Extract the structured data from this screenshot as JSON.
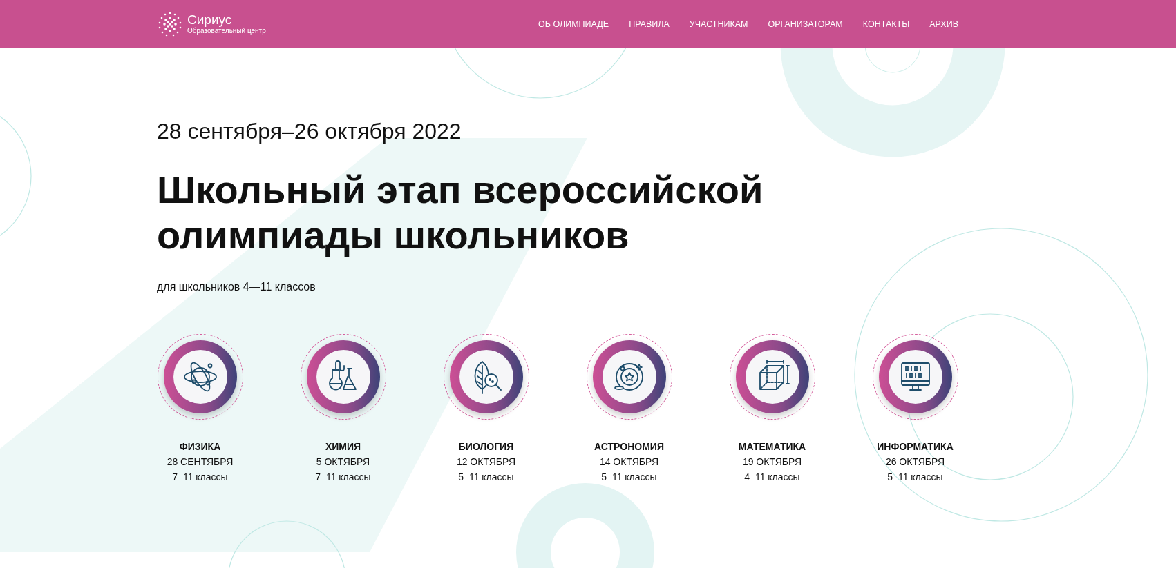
{
  "header": {
    "logo": {
      "name": "Сириус",
      "tagline": "Образовательный центр"
    },
    "nav": [
      "ОБ ОЛИМПИАДЕ",
      "ПРАВИЛА",
      "УЧАСТНИКАМ",
      "ОРГАНИЗАТОРАМ",
      "КОНТАКТЫ",
      "АРХИВ"
    ]
  },
  "hero": {
    "dates": "28 сентября–26 октября 2022",
    "title": "Школьный этап всероссийской олимпиады школьников",
    "subtitle": "для школьников 4—11 классов"
  },
  "subjects": [
    {
      "kind": "atom",
      "name": "ФИЗИКА",
      "date": "28 СЕНТЯБРЯ",
      "grades": "7–11 классы"
    },
    {
      "kind": "flasks",
      "name": "ХИМИЯ",
      "date": "5 ОКТЯБРЯ",
      "grades": "7–11 классы"
    },
    {
      "kind": "leaf",
      "name": "БИОЛОГИЯ",
      "date": "12 ОКТЯБРЯ",
      "grades": "5–11 классы"
    },
    {
      "kind": "orbit",
      "name": "АСТРОНОМИЯ",
      "date": "14 ОКТЯБРЯ",
      "grades": "5–11 классы"
    },
    {
      "kind": "cube",
      "name": "МАТЕМАТИКА",
      "date": "19 ОКТЯБРЯ",
      "grades": "4–11 классы"
    },
    {
      "kind": "monitor",
      "name": "ИНФОРМАТИКА",
      "date": "26 ОКТЯБРЯ",
      "grades": "5–11 классы"
    }
  ]
}
